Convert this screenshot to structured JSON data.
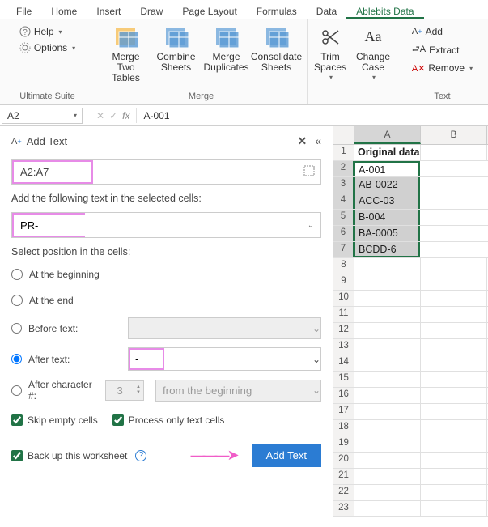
{
  "tabs": [
    "File",
    "Home",
    "Insert",
    "Draw",
    "Page Layout",
    "Formulas",
    "Data",
    "Ablebits Data"
  ],
  "active_tab": 7,
  "ribbon": {
    "group1": {
      "label": "Ultimate Suite",
      "help": "Help",
      "options": "Options"
    },
    "group2": {
      "label": "Merge",
      "items": [
        "Merge Two Tables",
        "Combine Sheets",
        "Merge Duplicates",
        "Consolidate Sheets"
      ]
    },
    "group3": {
      "trim": "Trim Spaces",
      "case": "Change Case"
    },
    "group4": {
      "label": "Text",
      "add": "Add",
      "extract": "Extract",
      "remove": "Remove"
    }
  },
  "formula_bar": {
    "name": "A2",
    "fx": "fx",
    "value": "A-001"
  },
  "pane": {
    "title": "Add Text",
    "range": "A2:A7",
    "label_add": "Add the following text in the selected cells:",
    "text_to_add": "PR-",
    "label_pos": "Select position in the cells:",
    "opt_begin": "At the beginning",
    "opt_end": "At the end",
    "opt_before": "Before text:",
    "opt_after": "After text:",
    "opt_charnum": "After character #:",
    "after_text_val": "-",
    "charnum_val": "3",
    "charnum_from": "from the beginning",
    "chk_skip": "Skip empty cells",
    "chk_textonly": "Process only text cells",
    "chk_backup": "Back up this worksheet",
    "btn": "Add Text"
  },
  "sheet": {
    "cols": [
      "A",
      "B"
    ],
    "header_row": [
      "Original data",
      ""
    ],
    "data": [
      "A-001",
      "AB-0022",
      "ACC-03",
      "B-004",
      "BA-0005",
      "BCDD-6"
    ],
    "total_rows": 23
  }
}
